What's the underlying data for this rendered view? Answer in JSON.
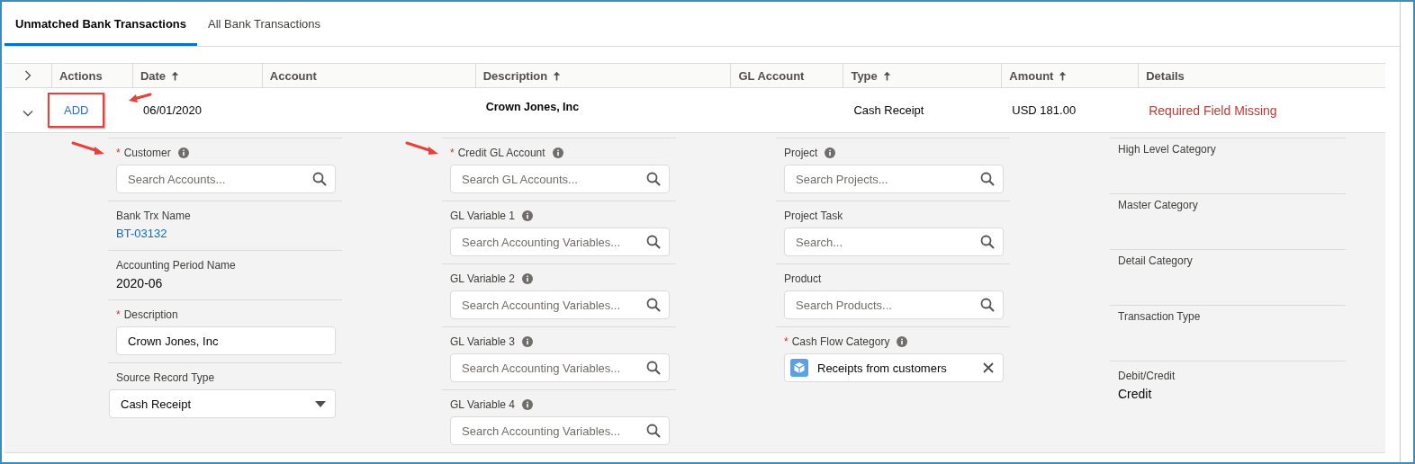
{
  "tabs": [
    {
      "label": "Unmatched Bank Transactions",
      "selected": true
    },
    {
      "label": "All Bank Transactions",
      "selected": false
    }
  ],
  "table": {
    "columns": [
      {
        "label": "Actions",
        "sort_ascending": false
      },
      {
        "label": "Date",
        "sort_ascending": true
      },
      {
        "label": "Account",
        "sort_ascending": false
      },
      {
        "label": "Description",
        "sort_ascending": true
      },
      {
        "label": "GL Account",
        "sort_ascending": false
      },
      {
        "label": "Type",
        "sort_ascending": true
      },
      {
        "label": "Amount",
        "sort_ascending": true
      },
      {
        "label": "Details",
        "sort_ascending": false
      }
    ],
    "rows": [
      {
        "expanded": true,
        "cells": [
          {
            "kind": "link",
            "text": "ADD",
            "highlighted": true
          },
          {
            "kind": "text",
            "text": "06/01/2020"
          },
          {
            "kind": "empty"
          },
          {
            "kind": "strong",
            "text": "Crown Jones, Inc"
          },
          {
            "kind": "empty"
          },
          {
            "kind": "text",
            "text": "Cash Receipt"
          },
          {
            "kind": "text",
            "text": "USD 181.00"
          },
          {
            "kind": "error",
            "text": "Required Field Missing"
          }
        ]
      }
    ]
  },
  "detail_columns": [
    [
      {
        "kind": "search",
        "label": "Customer",
        "required_mark": "*",
        "info": true,
        "highlighted": true,
        "placeholder": "Search Accounts..."
      },
      {
        "kind": "link",
        "label": "Bank Trx Name",
        "info": false,
        "highlighted": false,
        "value": "BT-03132"
      },
      {
        "kind": "text",
        "label": "Accounting Period Name",
        "info": false,
        "highlighted": false,
        "value": "2020-06"
      },
      {
        "kind": "input",
        "label": "Description",
        "required_mark": "*",
        "info": false,
        "highlighted": false,
        "value": "Crown Jones, Inc"
      },
      {
        "kind": "select",
        "label": "Source Record Type",
        "info": false,
        "highlighted": false,
        "value": "Cash Receipt"
      }
    ],
    [
      {
        "kind": "search",
        "label": "Credit GL Account",
        "required_mark": "*",
        "info": true,
        "highlighted": true,
        "placeholder": "Search GL Accounts..."
      },
      {
        "kind": "search",
        "label": "GL Variable 1",
        "info": true,
        "highlighted": false,
        "placeholder": "Search Accounting Variables..."
      },
      {
        "kind": "search",
        "label": "GL Variable 2",
        "info": true,
        "highlighted": false,
        "placeholder": "Search Accounting Variables..."
      },
      {
        "kind": "search",
        "label": "GL Variable 3",
        "info": true,
        "highlighted": false,
        "placeholder": "Search Accounting Variables..."
      },
      {
        "kind": "search",
        "label": "GL Variable 4",
        "info": true,
        "highlighted": false,
        "placeholder": "Search Accounting Variables..."
      }
    ],
    [
      {
        "kind": "search",
        "label": "Project",
        "info": true,
        "highlighted": false,
        "placeholder": "Search Projects..."
      },
      {
        "kind": "search",
        "label": "Project Task",
        "info": false,
        "highlighted": false,
        "placeholder": "Search..."
      },
      {
        "kind": "search",
        "label": "Product",
        "info": false,
        "highlighted": false,
        "placeholder": "Search Products..."
      },
      {
        "kind": "pill",
        "label": "Cash Flow Category",
        "required_mark": "*",
        "info": true,
        "highlighted": false,
        "value": "Receipts from customers"
      }
    ],
    [
      {
        "kind": "empty",
        "label": "High Level Category",
        "info": false,
        "highlighted": false
      },
      {
        "kind": "empty",
        "label": "Master Category",
        "info": false,
        "highlighted": false
      },
      {
        "kind": "empty",
        "label": "Detail Category",
        "info": false,
        "highlighted": false
      },
      {
        "kind": "empty",
        "label": "Transaction Type",
        "info": false,
        "highlighted": false
      },
      {
        "kind": "text",
        "label": "Debit/Credit",
        "info": false,
        "highlighted": false,
        "value": "Credit"
      }
    ]
  ]
}
